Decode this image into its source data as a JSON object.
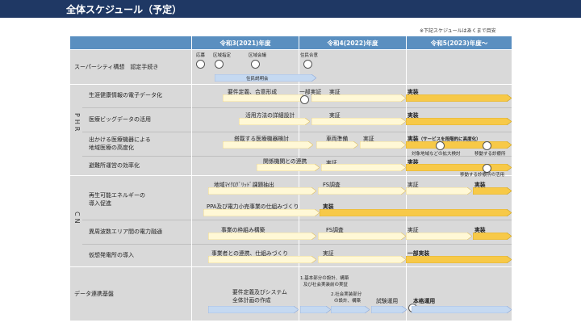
{
  "title": "全体スケジュール（予定）",
  "note": "※下記スケジュールはあくまで目安",
  "years": [
    "令和3(2021)年度",
    "令和4(2022)年度",
    "令和5(2023)年度～"
  ],
  "groups": {
    "phr": "PHR",
    "cn": "CN"
  },
  "rows": {
    "super": "スーパーシティ構想　認定手続き",
    "phr1": "生涯健康情報の電子データ化",
    "phr2": "医療ビッグデータの活用",
    "phr3a": "出かける医療機器による",
    "phr3b": "地域医療の高度化",
    "phr4": "避難所運営の効率化",
    "cn1a": "再生可能エネルギーの",
    "cn1b": "導入促進",
    "cn2": "異周波数エリア間の電力融通",
    "cn3": "仮想発電所の導入",
    "data": "データ連携基盤"
  },
  "milestones": {
    "apply": "応募",
    "designated": "区域指定",
    "council": "区域会議",
    "consent": "住民合意",
    "briefing": "住民説明会"
  },
  "tasks": {
    "phr1_req": "要件定義、合意形成",
    "phr1_pre": "一部実証",
    "phr1_verify": "実証",
    "phr1_impl": "実装",
    "phr2_detail": "活用方法の詳細設計",
    "phr2_verify": "実証",
    "phr2_impl": "実装",
    "phr3_study": "搭載する医療機器検討",
    "phr3_vehicle": "車両準備",
    "phr3_verify": "実証",
    "phr3_impl": "実装",
    "phr3_impl_note": "（サービスを段階的に高度化）",
    "phr3_expand": "対象地域などの拡大検討",
    "phr3_mobile": "移動する診療所",
    "phr4_coop": "関係機関との連携",
    "phr4_verify": "実証",
    "phr4_impl": "実装",
    "phr4_clinic": "移動する診療所の活用",
    "cn1_micro": "地域ﾏｲｸﾛｸﾞﾘｯﾄﾞ課題抽出",
    "cn1_fs": "FS調査",
    "cn1_verify": "実証",
    "cn1_impl": "実装",
    "cn1_ppa": "PPA及び電力小売事業の仕組みづくり",
    "cn1_ppa_impl": "実装",
    "cn2_frame": "事業の枠組み構築",
    "cn2_fs": "FS調査",
    "cn2_verify": "実証",
    "cn2_impl": "実装",
    "cn3_coop": "事業者との連携、仕組みづくり",
    "cn3_verify": "実証",
    "cn3_impl": "一部実装",
    "data_req1": "要件定義及びシステム",
    "data_req2": "全体計画の作成",
    "data_s1a": "1.基本部分の設計、構築",
    "data_s1b": "及び社会実装前の実証",
    "data_s2a": "2.社会実装部分",
    "data_s2b": "の設計、構築",
    "data_trial": "試験運用",
    "data_full": "本格運用"
  },
  "colors": {
    "title_bg": "#1f3864",
    "header_bg": "#5a8fc0",
    "row_bg": "#d9d9d9",
    "arrow_light": "#fff8d6",
    "arrow_full": "#f7c948",
    "arrow_blue": "#c5d9f1"
  }
}
